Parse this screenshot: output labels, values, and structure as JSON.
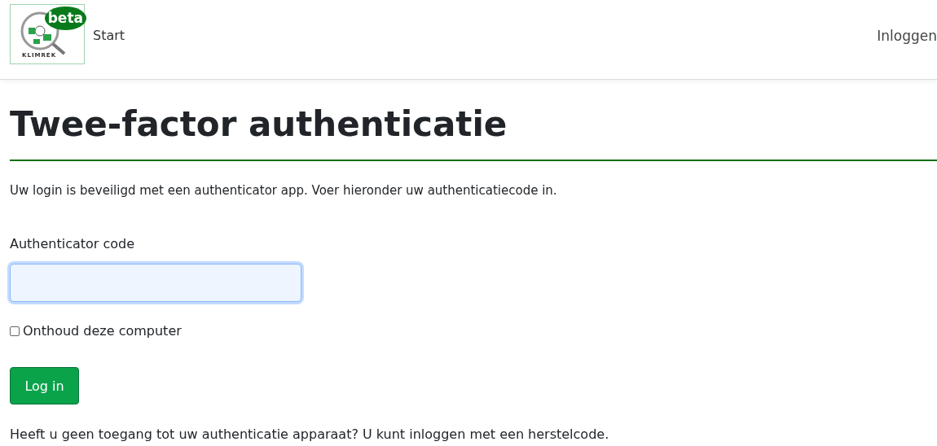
{
  "navbar": {
    "logo_badge": "beta",
    "logo_caption": "KLIMREK",
    "links": [
      {
        "label": "Start"
      }
    ],
    "login_link": "Inloggen"
  },
  "page": {
    "title": "Twee-factor authenticatie",
    "intro": "Uw login is beveiligd met een authenticator app. Voer hieronder uw authenticatiecode in.",
    "code_field": {
      "label": "Authenticator code",
      "focused": true
    },
    "remember": {
      "label": "Onthoud deze computer",
      "checked": false
    },
    "submit": "Log in",
    "footer_text": "Heeft u geen toegang tot uw authenticatie apparaat? U kunt inloggen met een herstelcode."
  }
}
